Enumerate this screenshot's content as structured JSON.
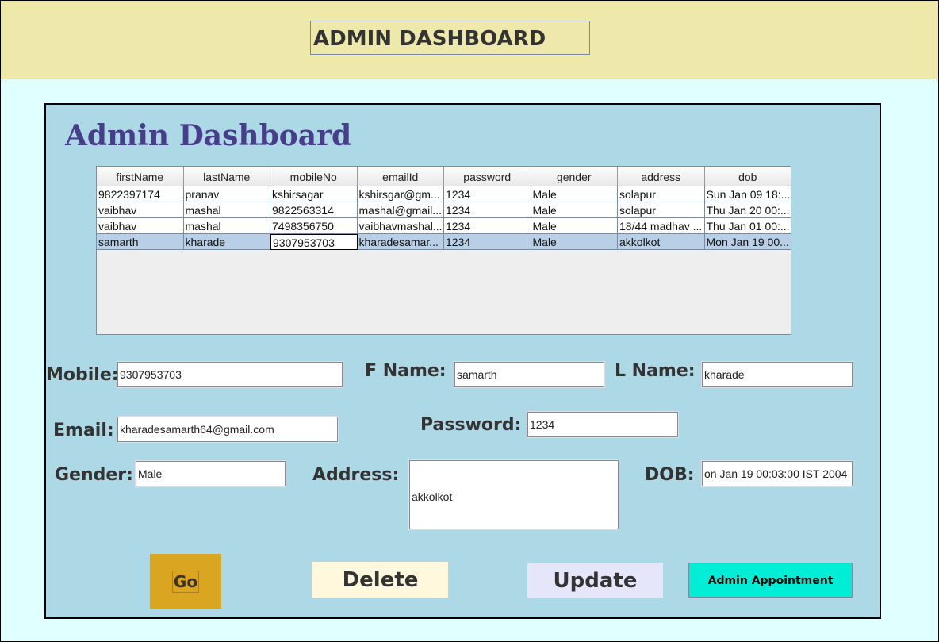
{
  "header": {
    "title": "ADMIN DASHBOARD"
  },
  "panel": {
    "title": "Admin Dashboard"
  },
  "table": {
    "columns": [
      "firstName",
      "lastName",
      "mobileNo",
      "emailId",
      "password",
      "gender",
      "address",
      "dob"
    ],
    "rows": [
      [
        "9822397174",
        "pranav",
        "kshirsagar",
        "kshirsgar@gm...",
        "1234",
        "Male",
        "solapur",
        "Sun Jan 09 18:..."
      ],
      [
        "vaibhav",
        "mashal",
        "9822563314",
        "mashal@gmail...",
        "1234",
        "Male",
        "solapur",
        "Thu Jan 20 00:..."
      ],
      [
        "vaibhav",
        "mashal",
        "7498356750",
        "vaibhavmashal...",
        "1234",
        "Male",
        "18/44 madhav ...",
        "Thu Jan 01 00:..."
      ],
      [
        "samarth",
        "kharade",
        "9307953703",
        "kharadesamar...",
        "1234",
        "Male",
        "akkolkot",
        "Mon Jan 19 00..."
      ]
    ]
  },
  "form": {
    "mobile_label": "Mobile:",
    "mobile_value": "9307953703",
    "fname_label": "F Name:",
    "fname_value": "samarth",
    "lname_label": "L Name:",
    "lname_value": "kharade",
    "email_label": "Email:",
    "email_value": "kharadesamarth64@gmail.com",
    "password_label": "Password:",
    "password_value": "1234",
    "gender_label": "Gender:",
    "gender_value": "Male",
    "address_label": "Address:",
    "address_value": "akkolkot",
    "dob_label": "DOB:",
    "dob_value": "on Jan 19 00:03:00 IST 2004"
  },
  "buttons": {
    "go": "Go",
    "delete": "Delete",
    "update": "Update",
    "appointment": "Admin Appointment"
  },
  "colors": {
    "header_bg": "#eee8aa",
    "panel_bg": "#add8e6",
    "title_color": "#483d8b",
    "go_bg": "#daa520",
    "delete_bg": "#fff8dc",
    "update_bg": "#e6e6fa",
    "appointment_bg": "#00eed5"
  }
}
